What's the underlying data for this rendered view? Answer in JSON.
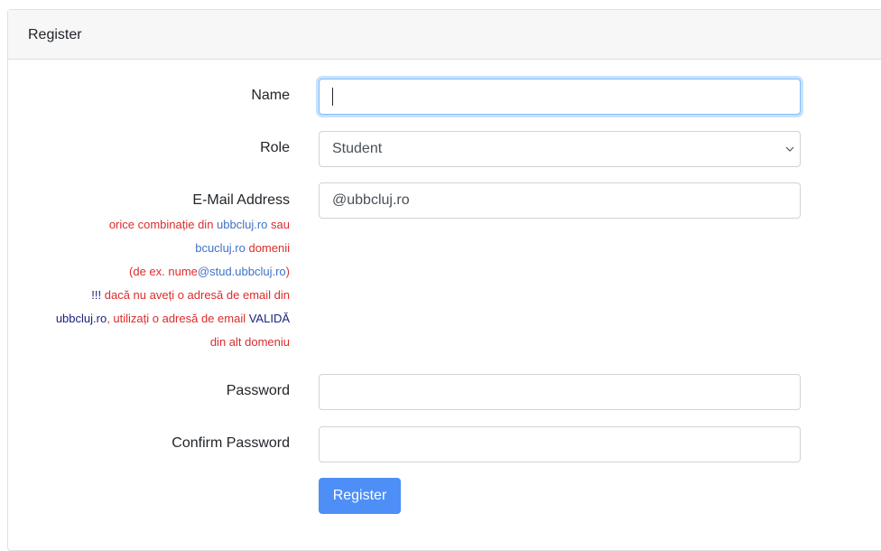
{
  "card": {
    "title": "Register"
  },
  "form": {
    "name_label": "Name",
    "name_value": "",
    "role_label": "Role",
    "role_value": "Student",
    "email_label": "E-Mail Address",
    "email_value": "@ubbcluj.ro",
    "email_note": {
      "l1_a": "orice combinație din ",
      "l1_b": "ubbcluj.ro",
      "l1_c": " sau",
      "l2_a": "bcucluj.ro",
      "l2_b": " domenii",
      "l3_a": "(de ex. nume",
      "l3_b": "@stud.ubbcluj.ro",
      "l3_c": ")",
      "l4_a": "!!!",
      "l4_b": " dacă nu aveți o adresă de email din",
      "l5_a": "ubbcluj.ro",
      "l5_b": ", utilizați o adresă de email ",
      "l5_c": "VALIDĂ",
      "l6": "din alt domeniu"
    },
    "password_label": "Password",
    "password_value": "",
    "confirm_label": "Confirm Password",
    "confirm_value": "",
    "submit_label": "Register"
  },
  "icons": {
    "select_caret": "chevron-down-icon"
  }
}
